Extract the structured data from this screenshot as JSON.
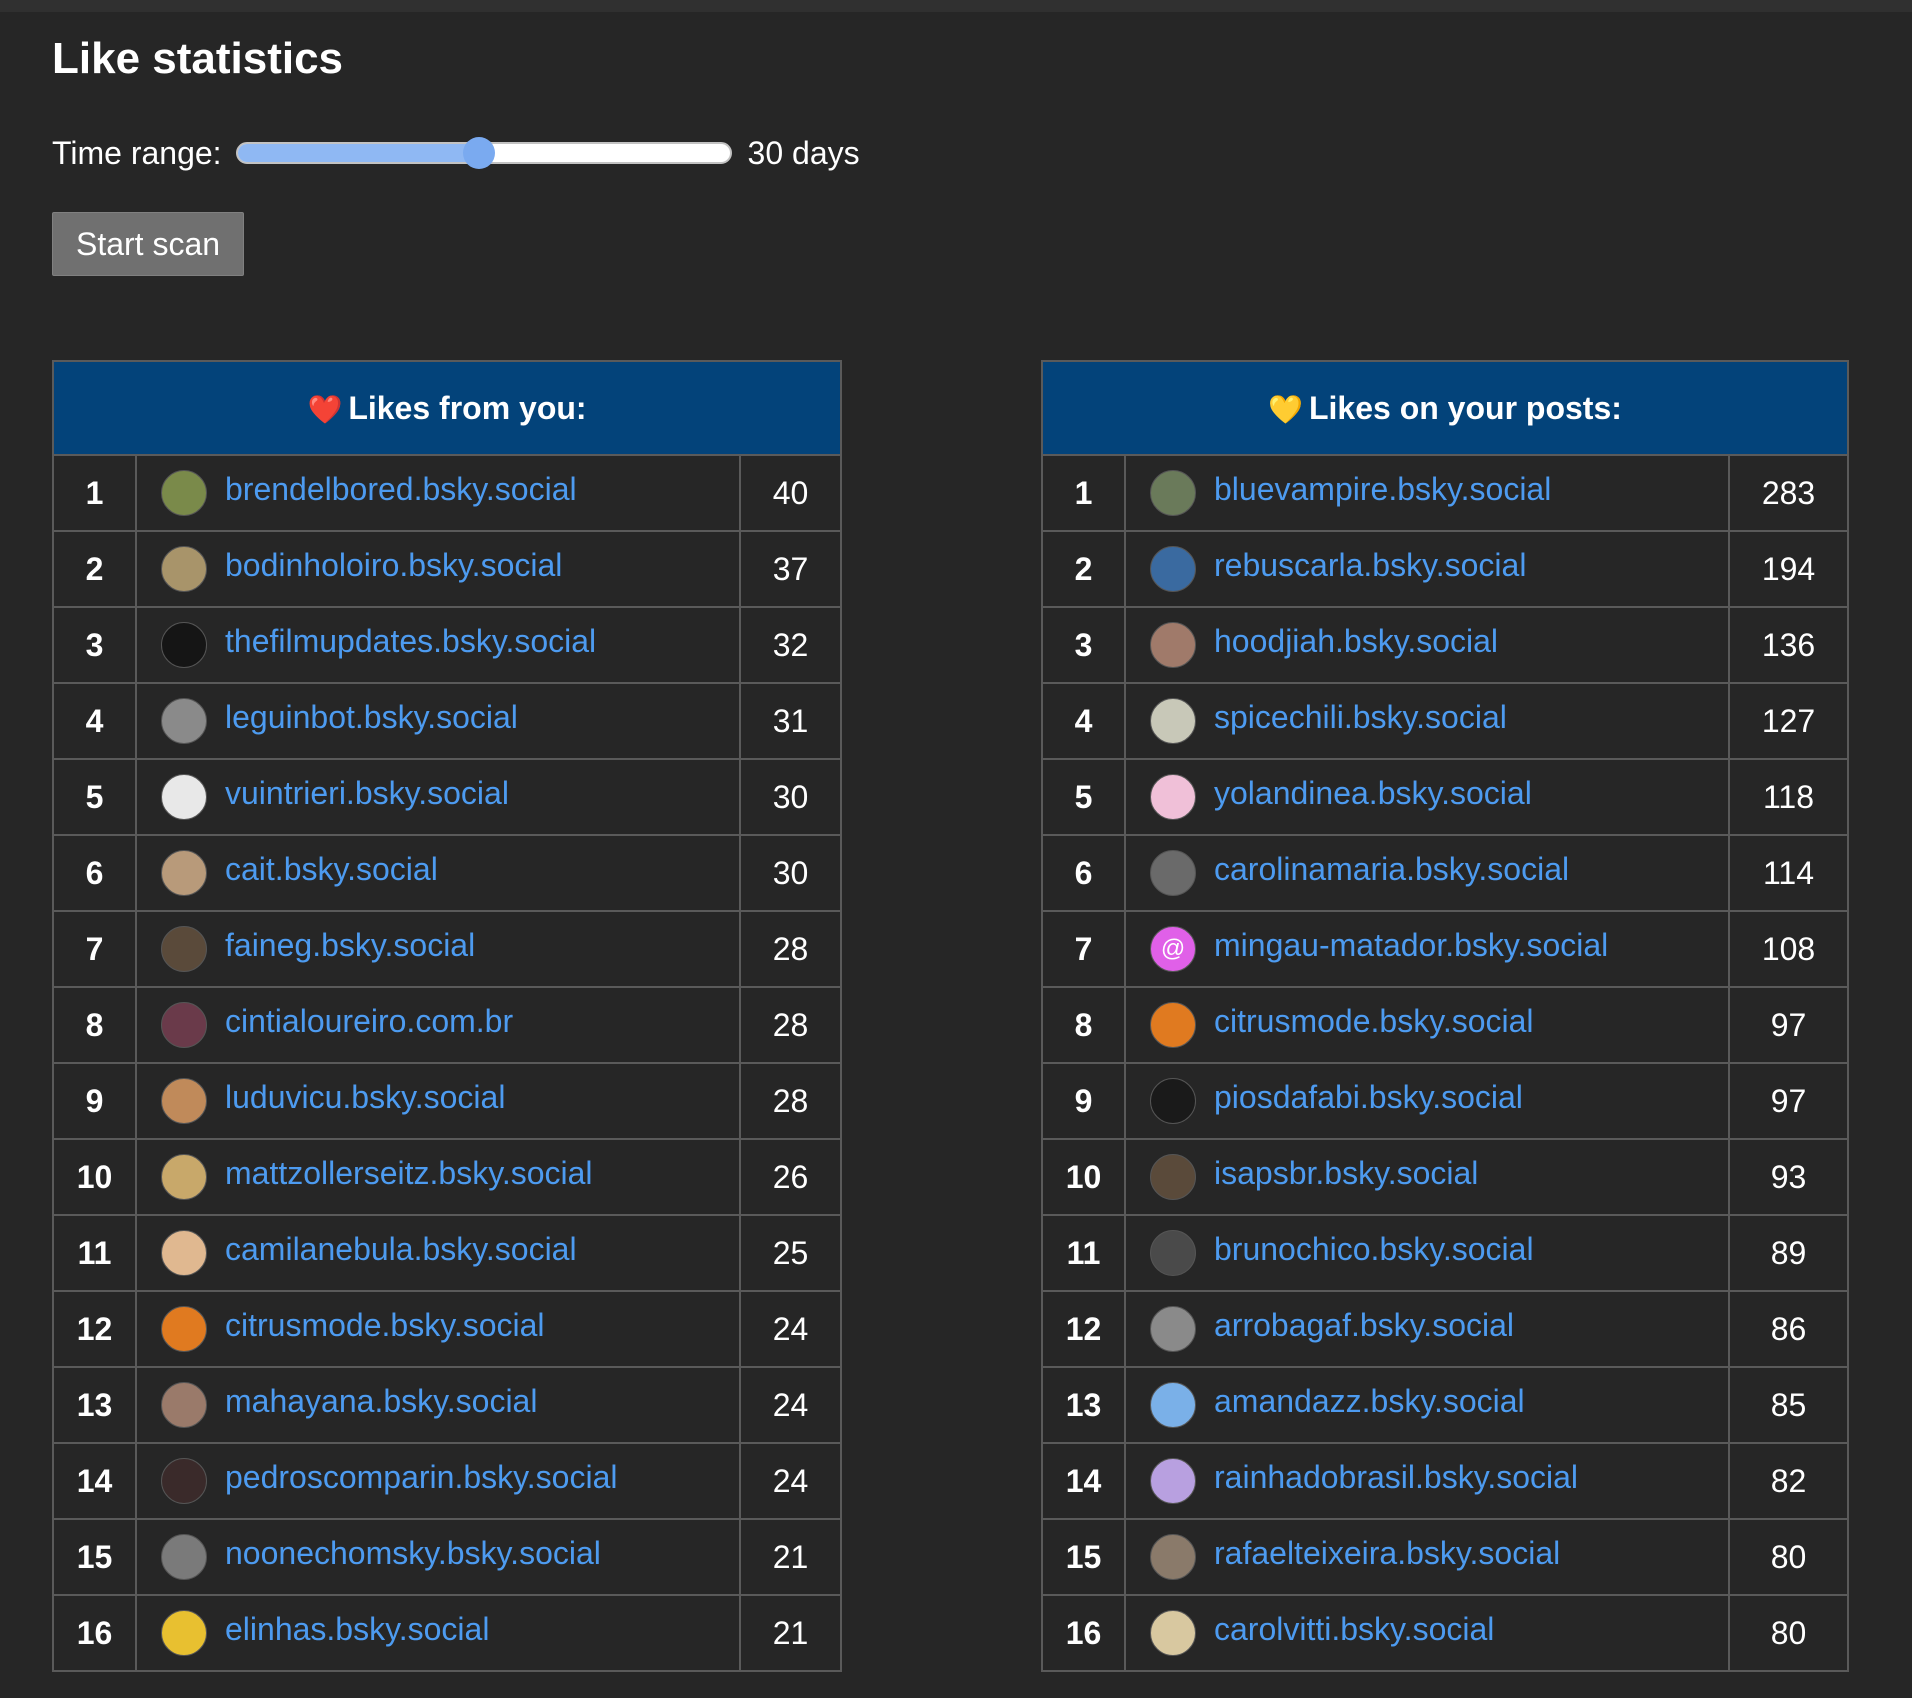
{
  "title": "Like statistics",
  "time_range": {
    "label": "Time range:",
    "value_text": "30 days",
    "fraction": 0.49
  },
  "scan_button": {
    "label": "Start scan"
  },
  "likes_from_you": {
    "heading_emoji": "❤️",
    "heading": "Likes from you:",
    "rows": [
      {
        "rank": "1",
        "handle": "brendelbored.bsky.social",
        "count": "40",
        "color": "#7a8a4a"
      },
      {
        "rank": "2",
        "handle": "bodinholoiro.bsky.social",
        "count": "37",
        "color": "#a8946a"
      },
      {
        "rank": "3",
        "handle": "thefilmupdates.bsky.social",
        "count": "32",
        "color": "#151515"
      },
      {
        "rank": "4",
        "handle": "leguinbot.bsky.social",
        "count": "31",
        "color": "#8a8a8a"
      },
      {
        "rank": "5",
        "handle": "vuintrieri.bsky.social",
        "count": "30",
        "color": "#e8e8e8"
      },
      {
        "rank": "6",
        "handle": "cait.bsky.social",
        "count": "30",
        "color": "#b89a7a"
      },
      {
        "rank": "7",
        "handle": "faineg.bsky.social",
        "count": "28",
        "color": "#5a4a3a"
      },
      {
        "rank": "8",
        "handle": "cintialoureiro.com.br",
        "count": "28",
        "color": "#6a3a4a"
      },
      {
        "rank": "9",
        "handle": "luduvicu.bsky.social",
        "count": "28",
        "color": "#c08a5a"
      },
      {
        "rank": "10",
        "handle": "mattzollerseitz.bsky.social",
        "count": "26",
        "color": "#c8a86a"
      },
      {
        "rank": "11",
        "handle": "camilanebula.bsky.social",
        "count": "25",
        "color": "#e0b890"
      },
      {
        "rank": "12",
        "handle": "citrusmode.bsky.social",
        "count": "24",
        "color": "#e07a20"
      },
      {
        "rank": "13",
        "handle": "mahayana.bsky.social",
        "count": "24",
        "color": "#9a7a6a"
      },
      {
        "rank": "14",
        "handle": "pedroscomparin.bsky.social",
        "count": "24",
        "color": "#3a2a2a"
      },
      {
        "rank": "15",
        "handle": "noonechomsky.bsky.social",
        "count": "21",
        "color": "#7a7a7a"
      },
      {
        "rank": "16",
        "handle": "elinhas.bsky.social",
        "count": "21",
        "color": "#e8c030"
      }
    ]
  },
  "likes_on_your_posts": {
    "heading_emoji": "💛",
    "heading": "Likes on your posts:",
    "rows": [
      {
        "rank": "1",
        "handle": "bluevampire.bsky.social",
        "count": "283",
        "color": "#6a7a5a"
      },
      {
        "rank": "2",
        "handle": "rebuscarla.bsky.social",
        "count": "194",
        "color": "#3a6aa0"
      },
      {
        "rank": "3",
        "handle": "hoodjiah.bsky.social",
        "count": "136",
        "color": "#a07a6a"
      },
      {
        "rank": "4",
        "handle": "spicechili.bsky.social",
        "count": "127",
        "color": "#c8c8b8"
      },
      {
        "rank": "5",
        "handle": "yolandinea.bsky.social",
        "count": "118",
        "color": "#f0c0d8"
      },
      {
        "rank": "6",
        "handle": "carolinamaria.bsky.social",
        "count": "114",
        "color": "#6a6a6a"
      },
      {
        "rank": "7",
        "handle": "mingau-matador.bsky.social",
        "count": "108",
        "color": "#e060e8",
        "glyph": "@"
      },
      {
        "rank": "8",
        "handle": "citrusmode.bsky.social",
        "count": "97",
        "color": "#e07a20"
      },
      {
        "rank": "9",
        "handle": "piosdafabi.bsky.social",
        "count": "97",
        "color": "#1a1a1a"
      },
      {
        "rank": "10",
        "handle": "isapsbr.bsky.social",
        "count": "93",
        "color": "#5a4a3a"
      },
      {
        "rank": "11",
        "handle": "brunochico.bsky.social",
        "count": "89",
        "color": "#4a4a4a"
      },
      {
        "rank": "12",
        "handle": "arrobagaf.bsky.social",
        "count": "86",
        "color": "#8a8a8a"
      },
      {
        "rank": "13",
        "handle": "amandazz.bsky.social",
        "count": "85",
        "color": "#7ab0e8"
      },
      {
        "rank": "14",
        "handle": "rainhadobrasil.bsky.social",
        "count": "82",
        "color": "#b8a0e0"
      },
      {
        "rank": "15",
        "handle": "rafaelteixeira.bsky.social",
        "count": "80",
        "color": "#8a7a6a"
      },
      {
        "rank": "16",
        "handle": "carolvitti.bsky.social",
        "count": "80",
        "color": "#d8c8a0"
      }
    ]
  }
}
